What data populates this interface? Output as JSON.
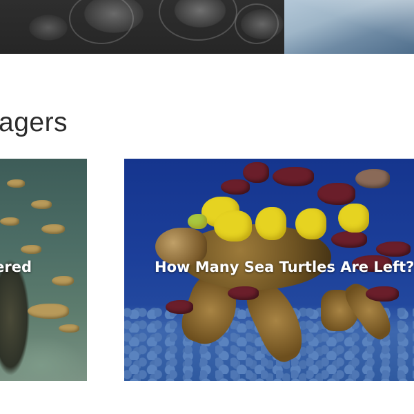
{
  "section": {
    "title": "agers"
  },
  "cards": [
    {
      "title": "angered"
    },
    {
      "title": "How Many Sea Turtles Are Left?"
    }
  ]
}
